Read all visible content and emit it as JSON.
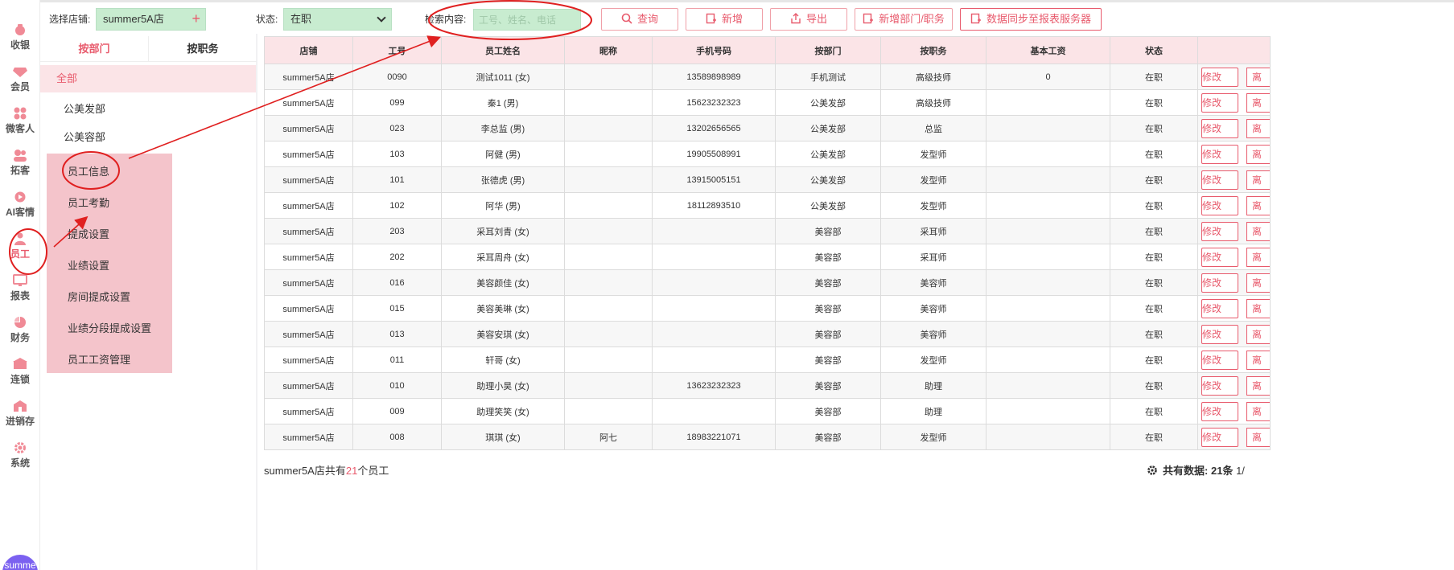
{
  "sidebar": {
    "items": [
      {
        "label": "收银",
        "icon": "cash-icon"
      },
      {
        "label": "会员",
        "icon": "member-icon"
      },
      {
        "label": "微客人",
        "icon": "guest-icon"
      },
      {
        "label": "拓客",
        "icon": "expand-icon"
      },
      {
        "label": "AI客情",
        "icon": "ai-icon"
      },
      {
        "label": "员工",
        "icon": "staff-icon"
      },
      {
        "label": "报表",
        "icon": "report-icon"
      },
      {
        "label": "财务",
        "icon": "finance-icon"
      },
      {
        "label": "连锁",
        "icon": "chain-icon"
      },
      {
        "label": "进销存",
        "icon": "inventory-icon"
      },
      {
        "label": "系统",
        "icon": "settings-icon"
      }
    ],
    "avatar_text": "summe"
  },
  "toolbar": {
    "store_label": "选择店铺:",
    "store_value": "summer5A店",
    "status_label": "状态:",
    "status_value": "在职",
    "search_label": "检索内容:",
    "search_placeholder": "工号、姓名、电话",
    "buttons": {
      "query": "查询",
      "add": "新增",
      "export": "导出",
      "add_dept": "新增部门/职务",
      "sync": "数据同步至报表服务器"
    }
  },
  "subsidebar": {
    "tab_dept": "按部门",
    "tab_role": "按职务",
    "all": "全部",
    "depts": [
      "公美发部",
      "公美容部"
    ],
    "menu": [
      "员工信息",
      "员工考勤",
      "提成设置",
      "业绩设置",
      "房间提成设置",
      "业绩分段提成设置",
      "员工工资管理"
    ]
  },
  "table": {
    "headers": [
      "店铺",
      "工号",
      "员工姓名",
      "昵称",
      "手机号码",
      "按部门",
      "按职务",
      "基本工资",
      "状态"
    ],
    "edit_label": "修改",
    "del_label": "离",
    "rows": [
      [
        "summer5A店",
        "0090",
        "测试1011 (女)",
        "",
        "13589898989",
        "手机测试",
        "高级技师",
        "0",
        "在职"
      ],
      [
        "summer5A店",
        "099",
        "秦1 (男)",
        "",
        "15623232323",
        "公美发部",
        "高级技师",
        "",
        "在职"
      ],
      [
        "summer5A店",
        "023",
        "李总监 (男)",
        "",
        "13202656565",
        "公美发部",
        "总监",
        "",
        "在职"
      ],
      [
        "summer5A店",
        "103",
        "阿健 (男)",
        "",
        "19905508991",
        "公美发部",
        "发型师",
        "",
        "在职"
      ],
      [
        "summer5A店",
        "101",
        "张德虎 (男)",
        "",
        "13915005151",
        "公美发部",
        "发型师",
        "",
        "在职"
      ],
      [
        "summer5A店",
        "102",
        "阿华 (男)",
        "",
        "18112893510",
        "公美发部",
        "发型师",
        "",
        "在职"
      ],
      [
        "summer5A店",
        "203",
        "采耳刘青 (女)",
        "",
        "",
        "美容部",
        "采耳师",
        "",
        "在职"
      ],
      [
        "summer5A店",
        "202",
        "采耳周舟 (女)",
        "",
        "",
        "美容部",
        "采耳师",
        "",
        "在职"
      ],
      [
        "summer5A店",
        "016",
        "美容颜佳 (女)",
        "",
        "",
        "美容部",
        "美容师",
        "",
        "在职"
      ],
      [
        "summer5A店",
        "015",
        "美容美琳 (女)",
        "",
        "",
        "美容部",
        "美容师",
        "",
        "在职"
      ],
      [
        "summer5A店",
        "013",
        "美容安琪 (女)",
        "",
        "",
        "美容部",
        "美容师",
        "",
        "在职"
      ],
      [
        "summer5A店",
        "011",
        "轩哥 (女)",
        "",
        "",
        "美容部",
        "发型师",
        "",
        "在职"
      ],
      [
        "summer5A店",
        "010",
        "助理小昊 (女)",
        "",
        "13623232323",
        "美容部",
        "助理",
        "",
        "在职"
      ],
      [
        "summer5A店",
        "009",
        "助理笑笑 (女)",
        "",
        "",
        "美容部",
        "助理",
        "",
        "在职"
      ],
      [
        "summer5A店",
        "008",
        "琪琪 (女)",
        "阿七",
        "18983221071",
        "美容部",
        "发型师",
        "",
        "在职"
      ]
    ]
  },
  "footer": {
    "summary_prefix": "summer5A店共有",
    "summary_count": "21",
    "summary_suffix": "个员工",
    "total_label": "共有数据:",
    "total_value": "21条",
    "page_text": "1/"
  },
  "colors": {
    "accent": "#e85a6c",
    "green_field": "#c8ecd0",
    "pink_bg": "#fbe4e7",
    "annotation": "#e02020"
  }
}
